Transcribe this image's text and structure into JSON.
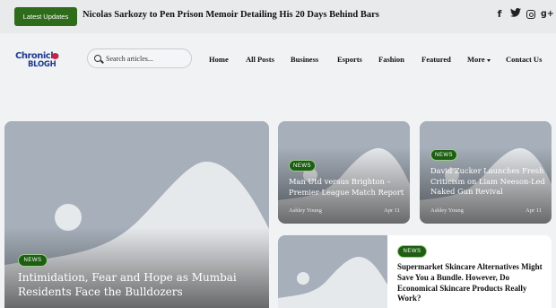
{
  "topbar": {
    "latest_label": "Latest Updates",
    "ticker_headline": "Nicolas Sarkozy to Pen Prison Memoir Detailing His 20 Days Behind Bars",
    "social": [
      {
        "icon": "facebook-icon",
        "glyph": "f"
      },
      {
        "icon": "twitter-icon",
        "glyph": "🐦"
      },
      {
        "icon": "instagram-icon",
        "glyph": ""
      },
      {
        "icon": "google-plus-icon",
        "glyph": "g+"
      }
    ]
  },
  "header": {
    "logo": {
      "line1": "Chronicle",
      "line2": "BLOGH"
    },
    "search_placeholder": "Search articles...",
    "nav": [
      {
        "label": "Home"
      },
      {
        "label": "All Posts"
      },
      {
        "label": "Business"
      },
      {
        "label": "Esports"
      },
      {
        "label": "Fashion"
      },
      {
        "label": "Featured"
      },
      {
        "label": "More"
      },
      {
        "label": "Contact Us"
      }
    ]
  },
  "cards": {
    "hero": {
      "tag": "NEWS",
      "title": "Intimidation, Fear and Hope as Mumbai Residents Face the Bulldozers"
    },
    "card1": {
      "tag": "NEWS",
      "title": "Man Utd versus Brighton – Premier League Match Report",
      "author": "Ashley Young",
      "date": "Apr 11"
    },
    "card2": {
      "tag": "NEWS",
      "title": "David Zucker Launches Fresh Criticism on Liam Neeson-Led Naked Gun Revival",
      "author": "Ashley Young",
      "date": "Apr 11"
    },
    "card3": {
      "tag": "NEWS",
      "title": "Supermarket Skincare Alternatives Might Save You a Bundle. However, Do Economical Skincare Products Really Work?"
    }
  },
  "colors": {
    "accent": "#2e6b1a",
    "badge": "#1e5e13",
    "placeholder": "#a6afba",
    "logo": "#1f3b8f"
  }
}
